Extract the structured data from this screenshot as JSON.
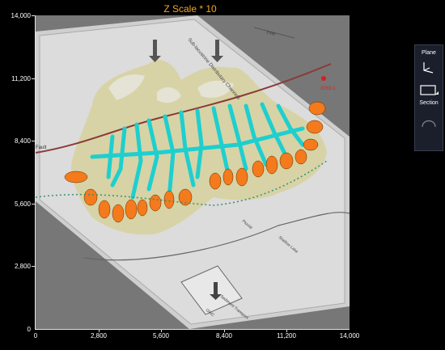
{
  "title": "Z Scale * 10",
  "y_ticks": [
    "14,000",
    "11,200",
    "8,400",
    "5,600",
    "2,800",
    "0"
  ],
  "x_ticks": [
    "0",
    "2,800",
    "5,600",
    "8,400",
    "11,200",
    "14,000"
  ],
  "toolbar": {
    "plane_label": "Plane",
    "section_label": "Section"
  },
  "map_labels": {
    "channels": "Sub-lacustrine Distributary Channels",
    "fault": "Fault",
    "pluvial": "Pluvial",
    "shallow_lake": "Shallow Lake",
    "sediment_transport": "Sediment Transport",
    "well": "3063-1",
    "scale_bar": "3 km",
    "owc": "OWC"
  },
  "colors": {
    "background": "#000000",
    "plot_bg": "#777777",
    "fan": "#d6d1a0",
    "channel": "#1ecfcf",
    "sand_lobe": "#f47a1c",
    "fault": "#8b3a3a",
    "title": "#f5a623"
  }
}
